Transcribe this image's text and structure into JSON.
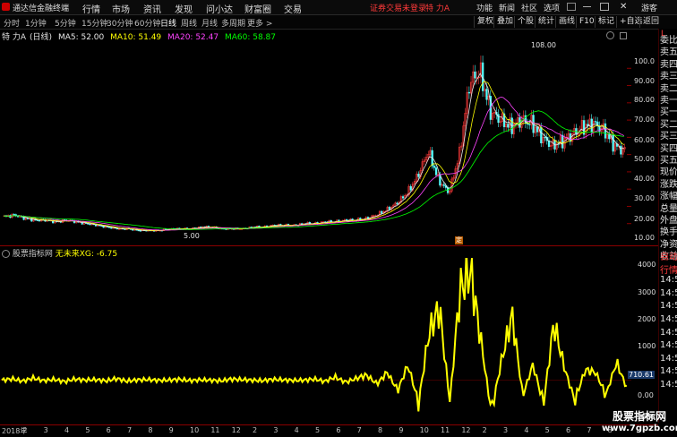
{
  "app": {
    "title": "通达信金融终端"
  },
  "top_menu": [
    "行情",
    "市场",
    "资讯",
    "发现",
    "问小达",
    "财富圈",
    "交易"
  ],
  "top_status": "证券交易未登录",
  "top_stock": "特 力A",
  "top_right": [
    "功能",
    "新闻",
    "社区",
    "选项"
  ],
  "top_user": "游客",
  "periods": [
    "分时",
    "1分钟",
    "5分钟",
    "15分钟",
    "30分钟",
    "60分钟",
    "日线",
    "周线",
    "月线",
    "多周期",
    "更多 >"
  ],
  "tools": [
    "复权",
    "叠加",
    "个股",
    "统计",
    "画线",
    "F10",
    "标记",
    "+自选",
    "返回"
  ],
  "info": {
    "stock": "特 力A",
    "period": "(日线)",
    "ma5": "MA5: 52.00",
    "ma10": "MA10: 51.49",
    "ma20": "MA20: 52.47",
    "ma60": "MA60: 58.87"
  },
  "colors": {
    "up": "#ff3a3a",
    "down": "#54ffff",
    "ma5": "#e8e8e8",
    "ma10": "#ffff00",
    "ma20": "#ff44ff",
    "ma60": "#00ff00",
    "indicator": "#ffff00"
  },
  "main_yticks": [
    "100.0",
    "90.00",
    "80.00",
    "70.00",
    "60.00",
    "50.00",
    "40.00",
    "30.00",
    "20.00",
    "10.00"
  ],
  "main_annotations": {
    "high": "108.00",
    "low": "5.00",
    "marker": "定"
  },
  "sub_header": {
    "name": "股票指标网",
    "formula": "无未来XG: -6.75"
  },
  "sub_yticks": [
    "4000",
    "3000",
    "2000",
    "1000",
    "0.00",
    "-1000"
  ],
  "sub_marker": "710.61",
  "right_labels_top": [
    "L",
    "委比",
    "卖五",
    "卖四",
    "卖三",
    "卖二",
    "卖一",
    "买一",
    "买二",
    "买三",
    "买四",
    "买五",
    "现价",
    "涨跌",
    "涨幅",
    "总量",
    "外盘",
    "换手",
    "净资",
    "收益"
  ],
  "right_labels_bottom": [
    "自动",
    "行情",
    "14:5",
    "14:5",
    "14:5",
    "14:5",
    "14:5",
    "14:5",
    "14:5",
    "14:5",
    "14:5"
  ],
  "date_ticks": [
    "2018年",
    "2",
    "3",
    "4",
    "5",
    "6",
    "7",
    "8",
    "9",
    "10",
    "11",
    "12",
    "2",
    "3",
    "4",
    "5",
    "6",
    "7",
    "8",
    "9",
    "10",
    "11",
    "12",
    "2",
    "3",
    "4",
    "5",
    "6",
    "7",
    "8"
  ],
  "watermark": {
    "line1": "股票指标网",
    "line2": "www.7gpzb.com"
  },
  "chart_data": [
    {
      "type": "candlestick",
      "title": "特 力A (日线)",
      "ylim": [
        0,
        110
      ],
      "max_label": 108.0,
      "min_label": 5.0,
      "series": [
        {
          "name": "MA5",
          "last": 52.0
        },
        {
          "name": "MA10",
          "last": 51.49
        },
        {
          "name": "MA20",
          "last": 52.47
        },
        {
          "name": "MA60",
          "last": 58.87
        }
      ],
      "close_path": [
        14,
        15,
        13,
        12,
        12,
        11,
        12,
        11,
        10,
        9,
        8,
        7,
        7,
        6,
        6,
        6,
        7,
        7,
        7,
        8,
        8,
        7,
        7,
        7,
        8,
        8,
        9,
        9,
        9,
        10,
        10,
        11,
        11,
        12,
        12,
        13,
        15,
        18,
        22,
        28,
        38,
        52,
        35,
        28,
        50,
        92,
        98,
        75,
        70,
        66,
        70,
        68,
        60,
        55,
        58,
        62,
        66,
        68,
        64,
        55,
        52
      ]
    },
    {
      "type": "line",
      "title": "无未来XG",
      "last": -6.75,
      "ylim": [
        -1500,
        4500
      ],
      "series": [
        {
          "name": "XG",
          "values": [
            0,
            50,
            -40,
            80,
            -20,
            30,
            -60,
            40,
            0,
            20,
            -30,
            60,
            -40,
            10,
            20,
            -10,
            0,
            30,
            -20,
            10,
            0,
            -30,
            40,
            20,
            0,
            -20,
            30,
            10,
            -10,
            0,
            40,
            -50,
            120,
            -80,
            60,
            200,
            -150,
            300,
            -400,
            600,
            -900,
            1800,
            2800,
            -800,
            3500,
            4200,
            1500,
            -1200,
            800,
            2500,
            -600,
            600,
            -900,
            2200,
            500,
            -800,
            400,
            300,
            -600,
            700,
            -300
          ]
        }
      ]
    }
  ]
}
